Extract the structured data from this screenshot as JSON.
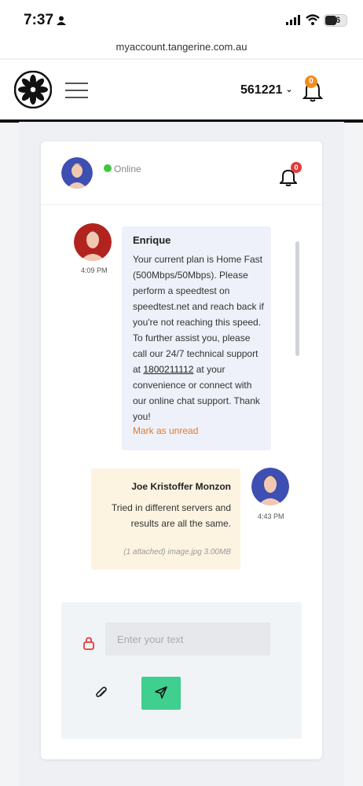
{
  "status_bar": {
    "time": "7:37",
    "battery": "56"
  },
  "browser": {
    "url": "myaccount.tangerine.com.au"
  },
  "header": {
    "account_number": "561221",
    "notification_count": "0"
  },
  "chat": {
    "status": "Online",
    "notification_count": "0",
    "messages": [
      {
        "sender": "Enrique",
        "time": "4:09 PM",
        "text_before_link": "Your current plan is Home Fast (500Mbps/50Mbps). Please perform a speedtest on speedtest.net and reach back if you're not reaching this speed. To further assist you, please call our 24/7 technical support at ",
        "phone": "1800211112",
        "text_after_link": " at your convenience or connect with our online chat support. Thank you!",
        "action": "Mark as unread"
      },
      {
        "sender": "Joe Kristoffer Monzon",
        "time": "4:43 PM",
        "text": "Tried in different servers and results are all the same.",
        "attachment": "(1 attached) image.jpg 3.00MB"
      }
    ],
    "composer": {
      "placeholder": "Enter your text"
    }
  },
  "colors": {
    "accent_orange": "#f28c1e",
    "badge_red": "#e23b3b",
    "send_green": "#3fcf8e",
    "online_green": "#3ec73e"
  },
  "icons": [
    "person-icon",
    "signal-icon",
    "wifi-icon",
    "battery-icon",
    "tangerine-logo",
    "hamburger-icon",
    "bell-icon",
    "lock-icon",
    "paperclip-icon",
    "send-icon"
  ]
}
